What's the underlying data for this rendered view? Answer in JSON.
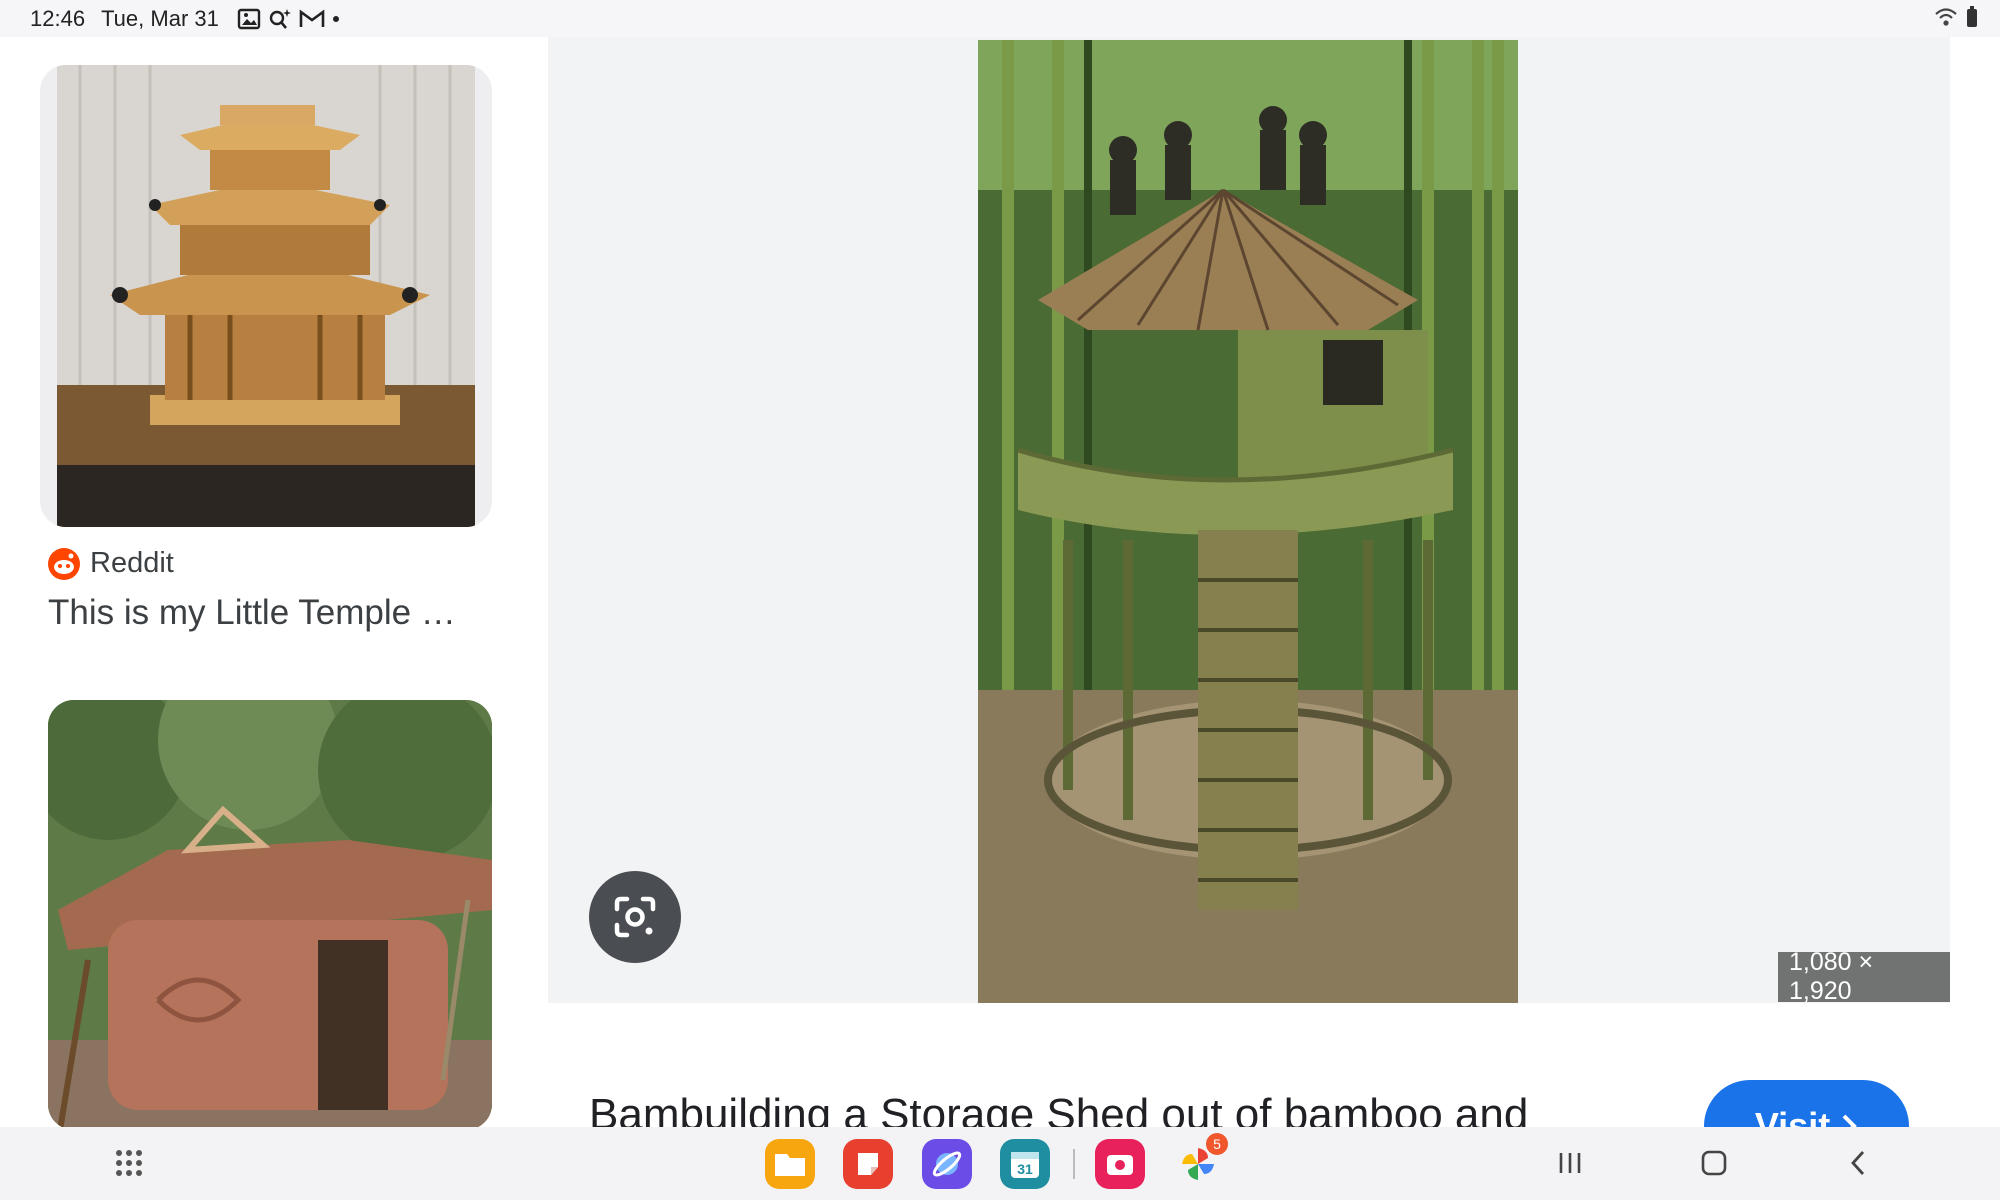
{
  "status_bar": {
    "time": "12:46",
    "date": "Tue, Mar 31",
    "icons": [
      "gallery-icon",
      "search-sparkle-icon",
      "gmail-icon",
      "dot-icon"
    ],
    "right_icons": [
      "wifi-icon",
      "battery-icon"
    ]
  },
  "left_results": [
    {
      "source": "Reddit",
      "source_icon": "reddit-icon",
      "title": "This is my Little Temple …",
      "image": "miniature-temple-photo"
    },
    {
      "image": "mud-hut-photo"
    }
  ],
  "preview": {
    "image": "bamboo-treehouse-photo",
    "dimensions": "1,080 × 1,920",
    "title": "Bambuilding a Storage Shed out of bamboo and upcycled materials (see boards made out of",
    "visit_label": "Visit",
    "lens_icon": "google-lens-icon"
  },
  "taskbar": {
    "apps": [
      "My Files",
      "Samsung Notes",
      "Samsung Internet",
      "Calendar",
      "Screen Recorder",
      "Photos"
    ],
    "calendar_day": "31",
    "photos_badge": "5",
    "colors": {
      "files": "#f8a60f",
      "notes": "#e7402f",
      "internet": "#6b4ce6",
      "calendar": "#1e8ea0",
      "recorder": "#e8215b",
      "visit_button": "#1a73e8"
    }
  }
}
